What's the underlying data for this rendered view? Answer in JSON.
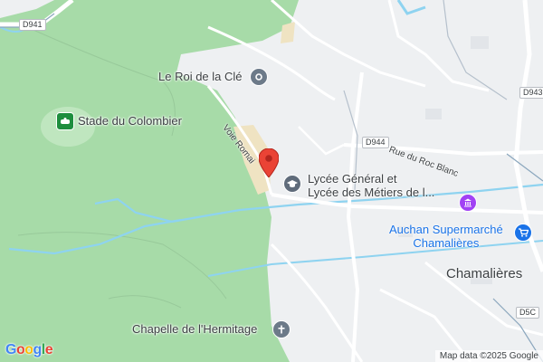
{
  "map": {
    "attribution": "Map data ©2025 Google",
    "logo_letters": [
      "G",
      "o",
      "o",
      "g",
      "l",
      "e"
    ],
    "logo_colors": [
      "#4285F4",
      "#EA4335",
      "#FBBC05",
      "#4285F4",
      "#34A853",
      "#EA4335"
    ],
    "colors": {
      "park": "#a7dba8",
      "road": "#ffffff",
      "water": "#8ed3f0",
      "poi_gray": "#6c7a89",
      "pin_red": "#ea4335",
      "school_gray": "#5f6b7a",
      "shopping_blue": "#1a73e8",
      "museum_purple": "#a142f4",
      "stadium_green": "#1e8e3e"
    }
  },
  "road_badges": {
    "d941": "D941",
    "d943": "D943",
    "d944": "D944",
    "d5c": "D5C"
  },
  "roads": {
    "voie_romaine": "Voie Romai",
    "rue_roc_blanc": "Rue du Roc Blanc"
  },
  "places": {
    "roi_de_la_cle": {
      "name": "Le Roi de la Clé",
      "icon": "building-icon"
    },
    "stade": {
      "name": "Stade du Colombier",
      "icon": "stadium-icon"
    },
    "lycee": {
      "line1": "Lycée Général et",
      "line2": "Lycée des Métiers de l...",
      "icon": "school-icon"
    },
    "auchan": {
      "line1": "Auchan Supermarché",
      "line2": "Chamalières",
      "icon": "shopping-cart-icon"
    },
    "chapelle": {
      "name": "Chapelle de l'Hermitage",
      "icon": "church-icon"
    },
    "museum": {
      "icon": "museum-icon"
    }
  },
  "city": "Chamalières"
}
